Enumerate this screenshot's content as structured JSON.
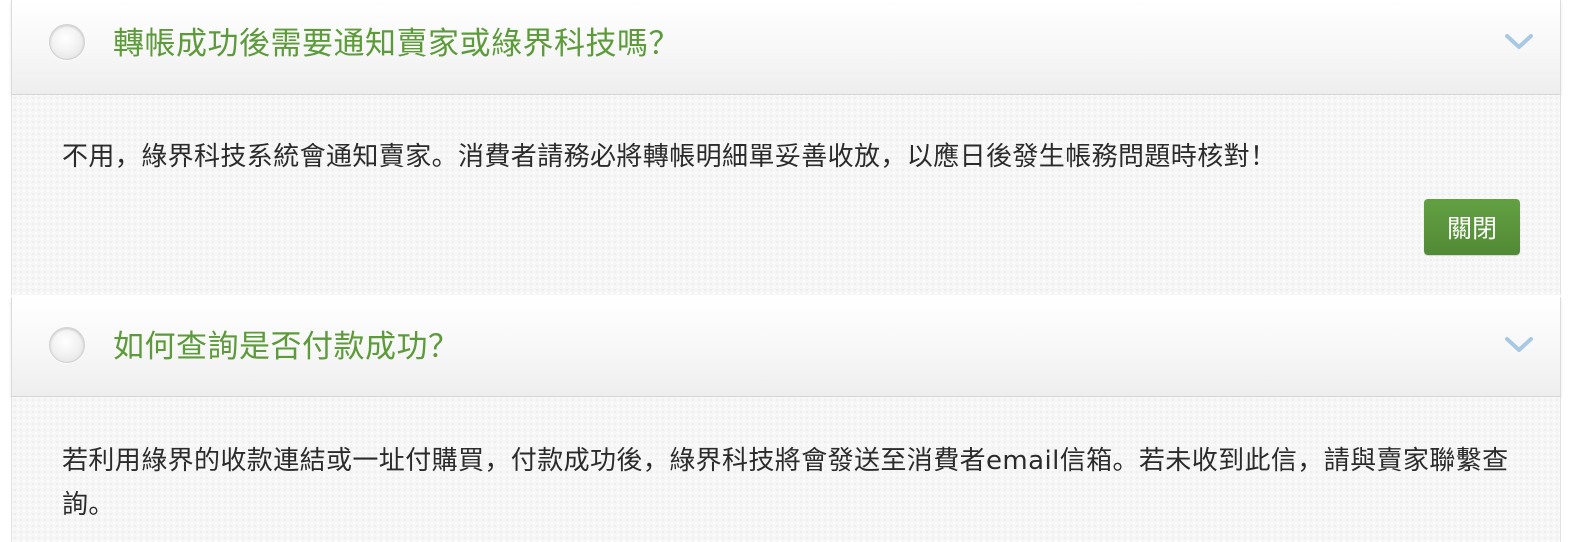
{
  "faq": {
    "items": [
      {
        "question": "轉帳成功後需要通知賣家或綠界科技嗎？",
        "answer": "不用，綠界科技系統會通知賣家。消費者請務必將轉帳明細單妥善收放，以應日後發生帳務問題時核對！",
        "close_label": "關閉"
      },
      {
        "question": "如何查詢是否付款成功？",
        "answer": "若利用綠界的收款連結或一址付購買，付款成功後，綠界科技將會發送至消費者email信箱。若未收到此信，請與賣家聯繫查詢。"
      }
    ]
  },
  "icons": {
    "expand": "chevron-down-icon",
    "selector": "radio-circle"
  },
  "colors": {
    "question_text": "#5c9a3a",
    "close_button": "#5a9a3c",
    "chevron": "#a9c9e3",
    "answer_text": "#2b2b2b"
  }
}
